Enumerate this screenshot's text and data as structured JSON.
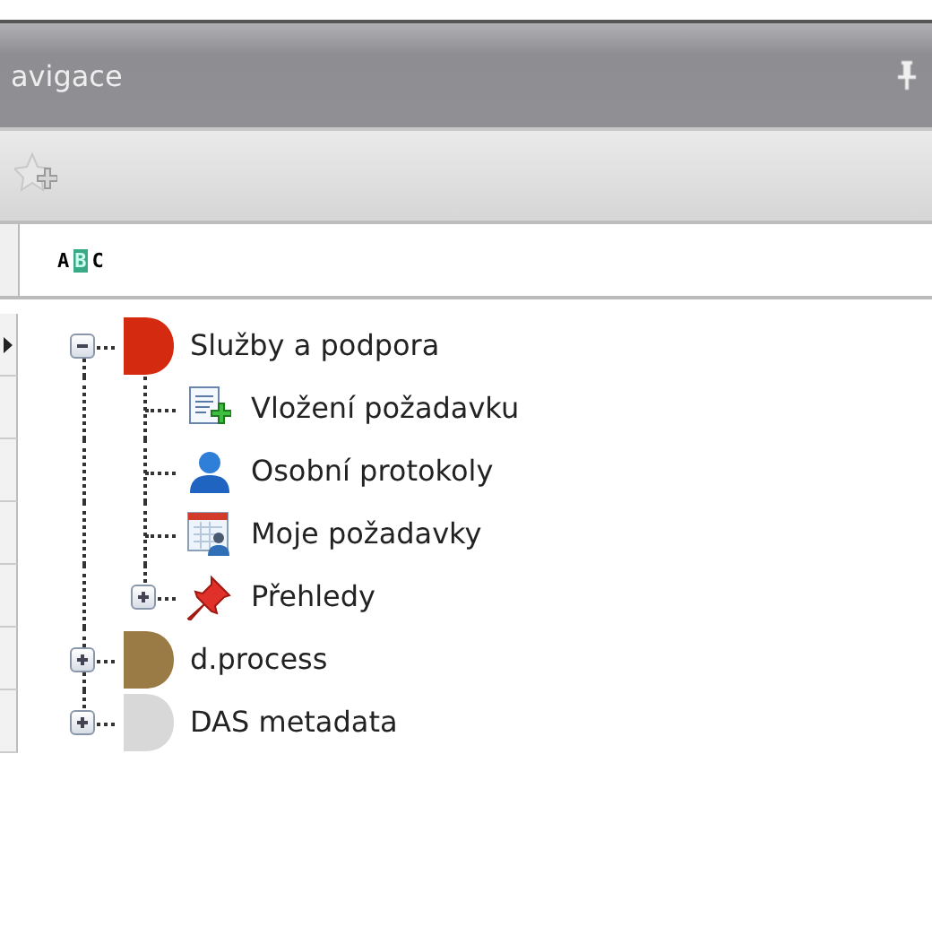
{
  "panel": {
    "title": "avigace"
  },
  "filter": {
    "sort_letters": "ABC"
  },
  "tree": [
    {
      "label": "Služby a podpora",
      "kind": "cylinder",
      "color": "#d42a10",
      "expanded": true,
      "selected": true,
      "children": [
        {
          "label": "Vložení požadavku",
          "kind": "document-plus",
          "selected": false
        },
        {
          "label": "Osobní protokoly",
          "kind": "person",
          "selected": false
        },
        {
          "label": "Moje požadavky",
          "kind": "calendar-person",
          "selected": false
        },
        {
          "label": "Přehledy",
          "kind": "pin",
          "expanded": false,
          "selected": false
        }
      ]
    },
    {
      "label": "d.process",
      "kind": "cylinder",
      "color": "#9a7a45",
      "expanded": false,
      "selected": false
    },
    {
      "label": "DAS metadata",
      "kind": "cylinder",
      "color": "#d8d8d8",
      "expanded": false,
      "selected": false
    }
  ]
}
